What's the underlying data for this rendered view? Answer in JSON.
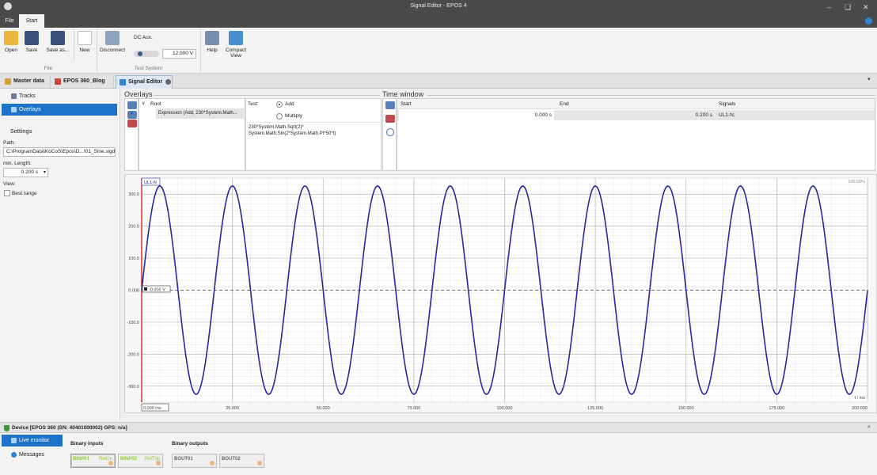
{
  "window": {
    "title": "Signal Editor - EPOS 4",
    "controls": [
      "minimize-icon",
      "restore-icon",
      "close-icon"
    ]
  },
  "menu": {
    "file": "File",
    "start": "Start",
    "help_icon": "info-icon"
  },
  "ribbon": {
    "open": "Open",
    "save": "Save",
    "save_as": "Save as...",
    "new": "New",
    "group_file": "File",
    "disconnect": "Disconnect",
    "dc_aux": "DC Aux.",
    "dc_value": "12.000 V",
    "group_test_system": "Test System",
    "help": "Help",
    "compact_view": "Compact View"
  },
  "doc_tabs": [
    "Master data",
    "EPOS 360_Blog",
    "Signal Editor"
  ],
  "left": {
    "tracks": "Tracks",
    "overlays": "Overlays",
    "settings": "Settings",
    "path_label": "Path:",
    "path_value": "C:\\ProgramData\\KoCoS\\Epos\\D...\\01_Sine.sigde",
    "min_length_label": "min. Length:",
    "min_length_value": "0.200 s",
    "view_label": "View:",
    "best_range": "Best range"
  },
  "overlays": {
    "title": "Overlays",
    "root": "Root",
    "expression": "Expression (Add, 230*System.Math...",
    "test_label": "Test:",
    "add": "Add",
    "multiply": "Multiply",
    "formula_line1": "230*System.Math.Sqrt(2)*",
    "formula_line2": "System.Math.Sin(2*System.Math.PI*50*t)"
  },
  "time_window": {
    "title": "Time window",
    "headers": [
      "Start",
      "End",
      "Signals"
    ],
    "row": [
      "0.000 s",
      "0.200 s",
      "UL1-N;"
    ]
  },
  "chart": {
    "series_label": "UL1-N",
    "zoom": "100.00%",
    "cursor_value": "-0.005 V",
    "xaxis_unit": "t / ms",
    "time_readout": "0.000 ms"
  },
  "chart_data": {
    "type": "line",
    "series": [
      {
        "name": "UL1-N",
        "color": "#2727a0"
      }
    ],
    "expression": "230*sqrt(2)*sin(2*pi*50*t)",
    "amplitude": 325.27,
    "frequency_hz": 50,
    "xlim": [
      0,
      200
    ],
    "ylim": [
      -350,
      350
    ],
    "x_ticks": [
      "0.000",
      "25.000",
      "50.000",
      "75.000",
      "100.000",
      "125.000",
      "150.000",
      "175.000",
      "200.000"
    ],
    "y_ticks": [
      "300.0",
      "200.0",
      "100.0",
      "0.000",
      "-100.0",
      "-200.0",
      "-300.0"
    ],
    "y_tick_values": [
      300,
      200,
      100,
      0,
      -100,
      -200,
      -300
    ],
    "x_tick_values": [
      0,
      25,
      50,
      75,
      100,
      125,
      150,
      175,
      200
    ],
    "grid": true
  },
  "device": {
    "label": "Device [EPOS 360 (SN: 40401000002) GPS: n/a]",
    "pin": "pin-icon"
  },
  "bottom": {
    "live_monitor": "Live monitor",
    "messages": "Messages",
    "binary_inputs": "Binary inputs",
    "binary_outputs": "Binary outputs",
    "binp01": "BINP01",
    "binp01_state": "RelOn",
    "binp02": "BINP02",
    "binp02_state": "RelTrip",
    "bout01": "BOUT01",
    "bout02": "BOUT02",
    "active_color": "#8cd41a"
  }
}
